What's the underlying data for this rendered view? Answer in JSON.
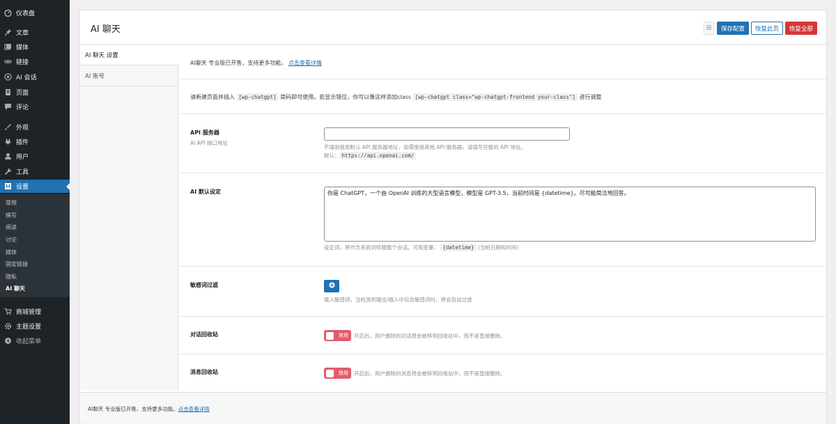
{
  "sidebar": {
    "items": [
      {
        "label": "仪表盘",
        "icon": "dashboard-icon"
      },
      {
        "label": "文章",
        "icon": "pin-icon"
      },
      {
        "label": "媒体",
        "icon": "media-icon"
      },
      {
        "label": "链接",
        "icon": "link-icon"
      },
      {
        "label": "AI 会话",
        "icon": "ai-icon"
      },
      {
        "label": "页面",
        "icon": "page-icon"
      },
      {
        "label": "评论",
        "icon": "comment-icon"
      },
      {
        "label": "外观",
        "icon": "brush-icon"
      },
      {
        "label": "插件",
        "icon": "plugin-icon"
      },
      {
        "label": "用户",
        "icon": "user-icon"
      },
      {
        "label": "工具",
        "icon": "wrench-icon"
      },
      {
        "label": "设置",
        "icon": "settings-icon"
      },
      {
        "label": "商城管理",
        "icon": "cart-icon"
      },
      {
        "label": "主题设置",
        "icon": "gear-icon"
      },
      {
        "label": "收起菜单",
        "icon": "collapse-icon"
      }
    ],
    "submenu": [
      "常规",
      "撰写",
      "阅读",
      "讨论",
      "媒体",
      "固定链接",
      "隐私",
      "AI 聊天"
    ]
  },
  "header": {
    "title": "AI 聊天",
    "save": "保存配置",
    "reset_page": "恢复此页",
    "reset_all": "恢复全部"
  },
  "tabs": [
    "AI 聊天 设置",
    "AI 账号"
  ],
  "notice": {
    "text": "AI聊天 专业版已开售，支持更多功能。",
    "link": "点击查看详情"
  },
  "shortcode": {
    "pre": "请新建页面并插入",
    "code1": "[wp-chatgpt]",
    "mid": "简码即可使用。若显示错位，你可以像这样添加class",
    "code2": "[wp-chatgpt class=\"wp-chatgpt-frontend your-class\"]",
    "post": "进行调整"
  },
  "api_server": {
    "label": "API 服务器",
    "sublabel": "AI API 接口地址",
    "value": "",
    "desc": "不填则使用默认 API 服务器地址，如需使用其他 API 服务器，请填写完整的 API 地址。",
    "default_label": "默认：",
    "default_value": "https://api.openai.com/"
  },
  "ai_default": {
    "label": "AI 默认设定",
    "value": "你是 ChatGPT，一个由 OpenAI 训练的大型语言模型，模型是 GPT-3.5，当前时间是 {datetime}。尽可能简洁地回答。",
    "desc_pre": "设定词，将作为系统词伴随整个会话。可用变量：",
    "var": "{datetime}",
    "desc_post": "(当前日期和时间)"
  },
  "sensitive": {
    "label": "敏感词过滤",
    "desc": "输入敏感词，当检测到输出/输入中包含敏感词时，将会自动过滤"
  },
  "chat_recycle": {
    "label": "对话回收站",
    "toggle": "禁用",
    "desc": "开启后，用户删除的对话将会被移到回收站中，而不是直接删除。"
  },
  "msg_recycle": {
    "label": "消息回收站",
    "toggle": "禁用",
    "desc": "开启后，用户删除的消息将会被移到回收站中，而不是直接删除。"
  },
  "footer": {
    "text": "AI聊天 专业版已开售，支持更多功能。",
    "link": "点击查看详情"
  },
  "colors": {
    "sidebar_bg": "#1d2327",
    "accent": "#2271b1",
    "danger": "#d63638",
    "toggle_off": "#e35d6a"
  }
}
